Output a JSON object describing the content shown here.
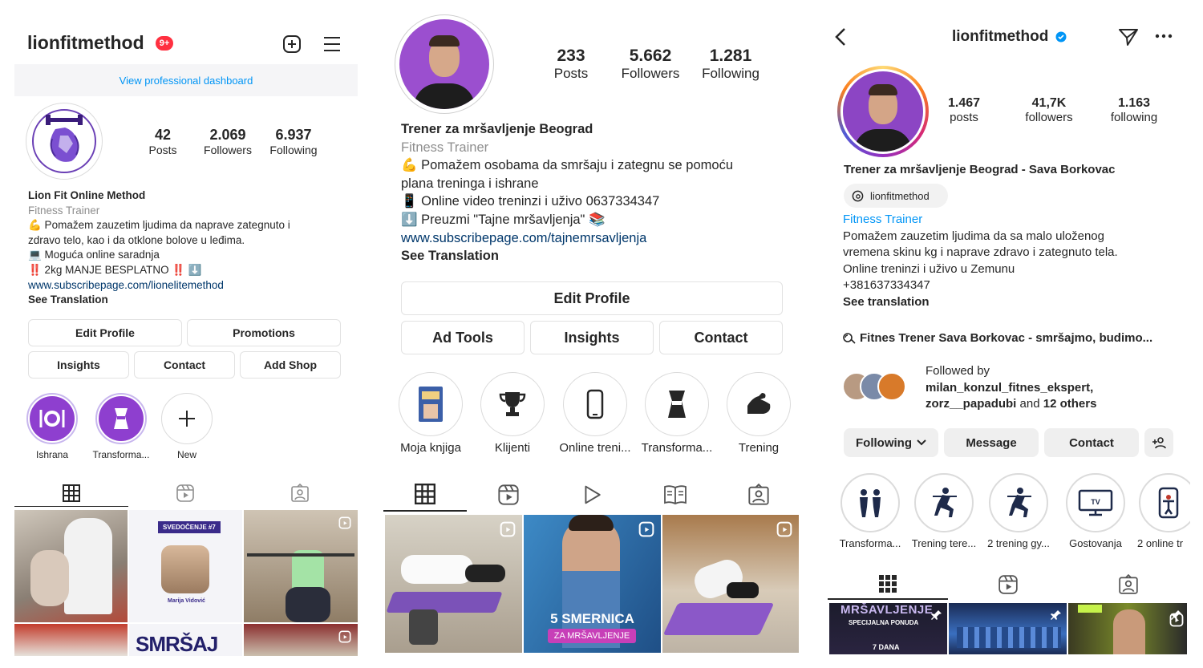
{
  "p1": {
    "username": "lionfitmethod",
    "notif_badge": "9+",
    "dashboard_link": "View professional dashboard",
    "stats": [
      {
        "n": "42",
        "l": "Posts"
      },
      {
        "n": "2.069",
        "l": "Followers"
      },
      {
        "n": "6.937",
        "l": "Following"
      }
    ],
    "name": "Lion Fit Online Method",
    "category": "Fitness Trainer",
    "bio": [
      "💪 Pomažem zauzetim ljudima da naprave zategnuto i",
      "zdravo telo, kao i da otklone bolove u leđima.",
      "💻 Moguća online saradnja",
      "‼️ 2kg MANJE BESPLATNO ‼️ ⬇️"
    ],
    "link": "www.subscribepage.com/lionelitemethod",
    "see_translation": "See Translation",
    "buttons": {
      "edit": "Edit Profile",
      "promotions": "Promotions",
      "insights": "Insights",
      "contact": "Contact",
      "add_shop": "Add Shop"
    },
    "highlights": [
      {
        "label": "Ishrana",
        "icon": "plate-icon"
      },
      {
        "label": "Transforma...",
        "icon": "body-icon"
      },
      {
        "label": "New",
        "icon": "plus-icon"
      }
    ],
    "grid_texts": {
      "tile2_badge": "SVEDOČENJE #7",
      "tile2_name": "Marija Vidović",
      "tile5_text": "SMRŠAJ"
    }
  },
  "p2": {
    "stats": [
      {
        "n": "233",
        "l": "Posts"
      },
      {
        "n": "5.662",
        "l": "Followers"
      },
      {
        "n": "1.281",
        "l": "Following"
      }
    ],
    "name": "Trener za mršavljenje Beograd",
    "category": "Fitness Trainer",
    "bio": [
      "💪 Pomažem osobama da smršaju i zategnu se pomoću",
      "plana treninga i ishrane",
      "📱 Online video treninzi i uživo 0637334347",
      "⬇️ Preuzmi \"Tajne mršavljenja\" 📚"
    ],
    "link": "www.subscribepage.com/tajnemrsavljenja",
    "see_translation": "See Translation",
    "buttons": {
      "edit": "Edit Profile",
      "ad_tools": "Ad Tools",
      "insights": "Insights",
      "contact": "Contact"
    },
    "highlights": [
      {
        "label": "Moja knjiga",
        "icon": "book-icon"
      },
      {
        "label": "Klijenti",
        "icon": "trophy-icon"
      },
      {
        "label": "Online treni...",
        "icon": "phone-icon"
      },
      {
        "label": "Transforma...",
        "icon": "body-icon"
      },
      {
        "label": "Trening",
        "icon": "biceps-icon"
      }
    ],
    "grid_texts": {
      "tile2_title": "5 SMERNICA",
      "tile2_sub": "ZA MRŠAVLJENJE"
    }
  },
  "p3": {
    "username": "lionfitmethod",
    "stats": [
      {
        "n": "1.467",
        "l": "posts"
      },
      {
        "n": "41,7K",
        "l": "followers"
      },
      {
        "n": "1.163",
        "l": "following"
      }
    ],
    "name": "Trener za mršavljenje Beograd - Sava Borkovac",
    "threads_handle": "lionfitmethod",
    "category": "Fitness Trainer",
    "bio": [
      "Pomažem zauzetim ljudima da sa malo uloženog",
      "vremena skinu kg i naprave zdravo i zategnuto tela.",
      "Online treninzi i uživo u Zemunu",
      "+381637334347"
    ],
    "see_translation": "See translation",
    "channel": "Fitnes Trener Sava Borkovac - smršajmo, budimo...",
    "followed_by": {
      "line1": "Followed by",
      "names1": "milan_konzul_fitnes_ekspert,",
      "names2": "zorz__papadubi",
      "and_text": " and ",
      "others": "12 others"
    },
    "buttons": {
      "following": "Following",
      "message": "Message",
      "contact": "Contact"
    },
    "highlights": [
      {
        "label": "Transforma...",
        "icon": "couple-icon"
      },
      {
        "label": "Trening tere...",
        "icon": "squat-icon"
      },
      {
        "label": "2 trening gy...",
        "icon": "squat-icon"
      },
      {
        "label": "Gostovanja",
        "icon": "tv-icon"
      },
      {
        "label": "2 online tr",
        "icon": "phone-trainer-icon"
      }
    ],
    "grid_texts": {
      "tile1_title": "MRŠAVLJENJE",
      "tile1_sub": "SPECIJALNA PONUDA",
      "tile1_days": "7 DANA",
      "tv_label": "TV"
    }
  },
  "colors": {
    "link_blue": "#00376b",
    "accent_blue": "#0095f6",
    "purple": "#8e3fcf",
    "badge_red": "#ff3040"
  }
}
